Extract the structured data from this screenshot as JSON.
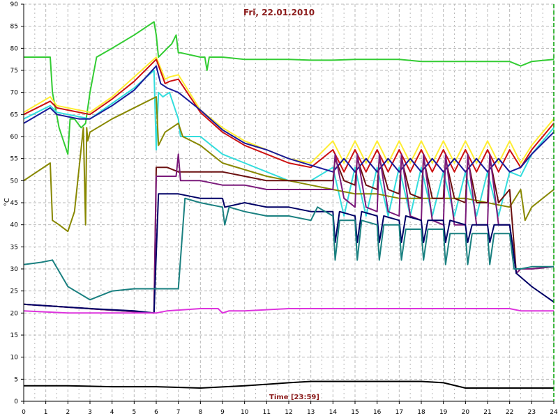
{
  "chart_data": {
    "type": "line",
    "title": "Fri, 22.01.2010",
    "xlabel": "Time [23:59]",
    "ylabel": "°C",
    "xlim": [
      0,
      24
    ],
    "ylim": [
      0,
      90
    ],
    "xticks": [
      0,
      1,
      2,
      3,
      4,
      5,
      6,
      7,
      8,
      9,
      10,
      11,
      12,
      13,
      14,
      15,
      16,
      17,
      18,
      19,
      20,
      21,
      22,
      23,
      24
    ],
    "yticks": [
      0,
      5,
      10,
      15,
      20,
      25,
      30,
      35,
      40,
      45,
      50,
      55,
      60,
      65,
      70,
      75,
      80,
      85,
      90
    ],
    "grid": true,
    "grid_style": "dashed",
    "colors": {
      "background": "#ffffff",
      "grid": "#b8b8b8",
      "axis": "#000000",
      "title": "#8b1a1a",
      "right_marker": "#00a000"
    },
    "series": [
      {
        "color": "#33cc33",
        "x": [
          0,
          1.2,
          1.3,
          1.6,
          2.0,
          2.1,
          2.3,
          2.6,
          2.8,
          3.0,
          3.3,
          4,
          5,
          5.9,
          6.0,
          6.1,
          6.5,
          6.7,
          6.9,
          7.0,
          7.1,
          8,
          8.2,
          8.3,
          8.4,
          9,
          10,
          11,
          12,
          13,
          14,
          15,
          16,
          17,
          18,
          19,
          20,
          21,
          22,
          22.5,
          23,
          24
        ],
        "y": [
          78,
          78,
          70,
          62,
          56,
          64,
          64,
          62,
          63,
          70,
          78,
          80,
          83,
          86,
          83,
          78,
          80,
          81,
          83,
          79,
          79,
          78,
          78,
          75,
          78,
          78,
          77.5,
          77.5,
          77.5,
          77.3,
          77.3,
          77.5,
          77.5,
          77.5,
          77,
          77,
          77,
          77,
          77,
          76,
          77,
          77.5
        ]
      },
      {
        "color": "#ffee33",
        "x": [
          0,
          1.2,
          1.5,
          2,
          2.5,
          3,
          4,
          5,
          6,
          6.4,
          6.6,
          7,
          8,
          9,
          10,
          11,
          12,
          13,
          14,
          14.5,
          15,
          15.5,
          16,
          16.5,
          17,
          17.5,
          18,
          18.5,
          19,
          19.5,
          20,
          20.5,
          21,
          21.5,
          22,
          22.5,
          23,
          24
        ],
        "y": [
          65.5,
          69,
          67,
          66.5,
          66,
          65.5,
          69,
          73.5,
          78,
          73,
          73.5,
          74,
          66,
          62,
          59,
          57,
          55,
          54,
          59,
          54,
          59,
          54,
          59,
          54,
          59,
          54,
          59,
          54,
          59,
          54,
          59,
          54,
          59,
          54,
          59,
          54,
          58,
          64
        ]
      },
      {
        "color": "#cc1111",
        "x": [
          0,
          1.2,
          1.5,
          2,
          2.5,
          3,
          4,
          5,
          6,
          6.4,
          6.6,
          7,
          8,
          9,
          10,
          11,
          12,
          13,
          14,
          14.5,
          15,
          15.5,
          16,
          16.5,
          17,
          17.5,
          18,
          18.5,
          19,
          19.5,
          20,
          20.5,
          21,
          21.5,
          22,
          22.5,
          23,
          24
        ],
        "y": [
          65,
          68,
          66.5,
          66,
          65.5,
          65,
          68.5,
          72.5,
          77.5,
          72,
          72.5,
          73,
          65.5,
          61,
          58,
          56,
          54,
          53,
          57,
          52,
          57,
          52,
          57,
          52,
          57,
          52,
          57,
          52,
          57,
          52,
          57,
          52,
          57,
          52,
          57,
          53,
          57,
          63
        ]
      },
      {
        "color": "#33dddd",
        "x": [
          0,
          1.2,
          1.5,
          2,
          2.5,
          3,
          4,
          5,
          5.9,
          6.0,
          6.1,
          6.3,
          6.6,
          7,
          7.1,
          8,
          9,
          10,
          11,
          12,
          13,
          14,
          14.5,
          15,
          15.5,
          16,
          16.5,
          17,
          17.5,
          18,
          18.5,
          19,
          19.5,
          20,
          20.5,
          21,
          21.5,
          22,
          22.5,
          23,
          24
        ],
        "y": [
          64,
          67,
          65.5,
          65,
          64.5,
          64,
          67.5,
          71,
          75,
          57,
          70,
          69,
          70,
          64,
          60,
          60,
          56,
          54,
          52,
          50,
          50,
          53,
          42,
          53,
          42,
          53,
          42,
          53,
          42,
          53,
          42,
          52,
          42,
          52,
          42,
          52,
          42,
          52,
          51,
          56,
          62
        ]
      },
      {
        "color": "#1a1a99",
        "x": [
          0,
          1.2,
          1.5,
          2,
          2.5,
          3,
          4,
          5,
          6,
          6.2,
          6.5,
          7,
          8,
          9,
          10,
          11,
          12,
          13,
          14,
          14.5,
          15,
          15.5,
          16,
          16.5,
          17,
          17.5,
          18,
          18.5,
          19,
          19.5,
          20,
          20.5,
          21,
          21.5,
          22,
          22.5,
          23,
          24
        ],
        "y": [
          63,
          66.5,
          65,
          64.5,
          64,
          64,
          67,
          70.5,
          76,
          72,
          71,
          70,
          66,
          61.5,
          58.5,
          57,
          55,
          53.5,
          52,
          55,
          52,
          55,
          52,
          55,
          52,
          55,
          52,
          55,
          52,
          55,
          52,
          55,
          52,
          55,
          52,
          53,
          56,
          61
        ]
      },
      {
        "color": "#888800",
        "x": [
          0,
          1.2,
          1.3,
          1.6,
          2.0,
          2.3,
          2.7,
          2.8,
          2.85,
          2.9,
          3.0,
          4,
          5,
          6,
          6.1,
          6.4,
          7,
          7.2,
          8,
          9,
          10,
          11,
          12,
          13,
          14,
          15,
          16,
          17,
          18,
          19,
          20,
          21,
          22,
          22.5,
          22.7,
          23,
          24
        ],
        "y": [
          50,
          54,
          41,
          40,
          38.5,
          43,
          62,
          40,
          62,
          59,
          61,
          64,
          66.5,
          69,
          58,
          61,
          63,
          60,
          58,
          54,
          52.5,
          51,
          50,
          49,
          48,
          47,
          47,
          46,
          46,
          46,
          46,
          45,
          44,
          48,
          41,
          44,
          48
        ]
      },
      {
        "color": "#6b1010",
        "x": [
          0,
          5.9,
          6.0,
          6.1,
          6.5,
          7,
          8,
          9,
          10,
          11,
          12,
          13,
          14,
          14.1,
          14.5,
          15,
          15.1,
          15.5,
          16,
          16.1,
          16.5,
          17,
          17.1,
          17.5,
          18,
          18.1,
          18.5,
          19,
          19.1,
          19.5,
          20,
          20.1,
          20.5,
          21,
          21.1,
          21.5,
          22,
          22.3,
          22.5,
          23,
          24
        ],
        "y": [
          22,
          20,
          53,
          53,
          53,
          52,
          52,
          52,
          51,
          50,
          50,
          50,
          50,
          55,
          50,
          49,
          55,
          49,
          48,
          55,
          48,
          47,
          55,
          47,
          46,
          55,
          46,
          46,
          55,
          46,
          45,
          55,
          45,
          45,
          55,
          45,
          48,
          29,
          30,
          30,
          30.5
        ]
      },
      {
        "color": "#7a1a7a",
        "x": [
          0,
          5.9,
          6.0,
          6.5,
          6.9,
          7.0,
          7.1,
          8,
          9,
          10,
          11,
          12,
          13,
          14,
          14.1,
          14.5,
          15,
          15.1,
          15.5,
          16,
          16.1,
          16.5,
          17,
          17.1,
          17.5,
          18,
          18.1,
          18.5,
          19,
          19.1,
          19.5,
          20,
          20.1,
          20.5,
          21,
          21.1,
          21.5,
          22,
          22.3,
          22.5,
          23,
          24
        ],
        "y": [
          22,
          20,
          51,
          51,
          51,
          56,
          50,
          50,
          49,
          49,
          48,
          48,
          48,
          48,
          56,
          46,
          44,
          56,
          44,
          43,
          56,
          43,
          42,
          56,
          42,
          41,
          56,
          41,
          40,
          56,
          40,
          40,
          56,
          40,
          40,
          56,
          40,
          40,
          29,
          30,
          30,
          30.5
        ]
      },
      {
        "color": "#000066",
        "x": [
          0,
          3,
          5,
          5.9,
          6.1,
          7,
          8,
          9,
          9.1,
          10,
          11,
          12,
          13,
          14,
          14.1,
          14.3,
          15,
          15.1,
          15.3,
          16,
          16.1,
          16.3,
          17,
          17.1,
          17.3,
          18,
          18.1,
          18.3,
          19,
          19.1,
          19.3,
          20,
          20.1,
          20.3,
          21,
          21.1,
          21.3,
          22,
          22.3,
          23,
          24
        ],
        "y": [
          22,
          21,
          20.5,
          20,
          47,
          47,
          46,
          46,
          44,
          45,
          44,
          44,
          43,
          43,
          36,
          43,
          42,
          36,
          43,
          42,
          36,
          42,
          41,
          36,
          42,
          41,
          36,
          41,
          41,
          36,
          41,
          40,
          36,
          40,
          40,
          36,
          40,
          40,
          29,
          26,
          22.5
        ]
      },
      {
        "color": "#1a8080",
        "x": [
          0,
          0.8,
          1.3,
          2,
          3,
          4,
          5,
          6.5,
          7.0,
          7.3,
          8,
          9,
          9.1,
          9.3,
          10,
          11,
          12,
          13,
          13.3,
          14,
          14.1,
          14.3,
          15,
          15.1,
          15.3,
          16,
          16.1,
          16.3,
          17,
          17.1,
          17.3,
          18,
          18.1,
          18.3,
          19,
          19.1,
          19.3,
          20,
          20.1,
          20.3,
          21,
          21.1,
          21.3,
          22,
          22.2,
          22.5,
          23,
          24
        ],
        "y": [
          31,
          31.5,
          32,
          26,
          23,
          25,
          25.5,
          25.5,
          25.5,
          46,
          45,
          44,
          40,
          44,
          43,
          42,
          42,
          41,
          44,
          42,
          32,
          41,
          41,
          32,
          41,
          40,
          32,
          40,
          40,
          32,
          39,
          39,
          32,
          39,
          39,
          31,
          38,
          38,
          31,
          38,
          38,
          31,
          38,
          38,
          30,
          30,
          30.5,
          30.5
        ]
      },
      {
        "color": "#dd33dd",
        "x": [
          0,
          2,
          4,
          5,
          6,
          6.5,
          8,
          8.8,
          9,
          9.3,
          10,
          12,
          14,
          16,
          18,
          20,
          21,
          22,
          22.5,
          23,
          24
        ],
        "y": [
          20.5,
          20,
          20,
          20,
          20,
          20.5,
          21,
          21,
          20,
          20.5,
          20.5,
          21,
          21,
          21,
          21,
          21,
          21,
          21,
          20.5,
          20.5,
          20.5
        ]
      },
      {
        "color": "#000000",
        "x": [
          0,
          2,
          4,
          6,
          8,
          10,
          12,
          13,
          14,
          15,
          16,
          17,
          18,
          19,
          20,
          21,
          22,
          23,
          24
        ],
        "y": [
          3.5,
          3.5,
          3.3,
          3.3,
          3.0,
          3.5,
          4.2,
          4.5,
          4.5,
          4.5,
          4.5,
          4.5,
          4.5,
          4.2,
          3.0,
          3.0,
          3.0,
          3.0,
          3.0
        ]
      }
    ]
  }
}
